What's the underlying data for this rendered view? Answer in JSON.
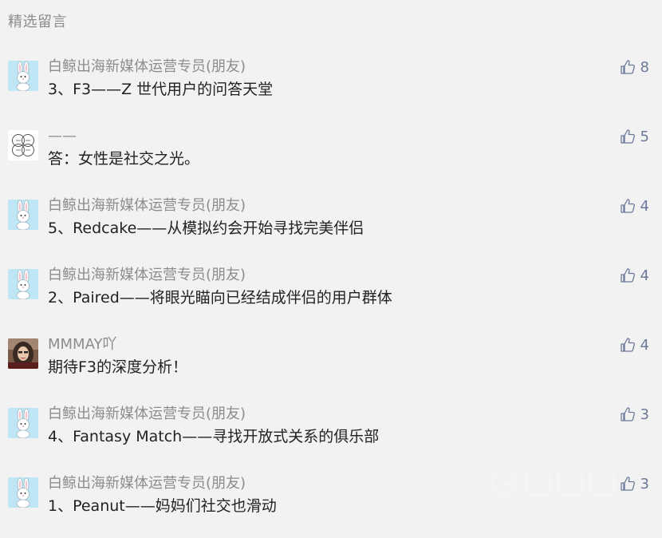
{
  "section_title": "精选留言",
  "comments": [
    {
      "avatar": "bunny-avatar",
      "nickname": "白鲸出海新媒体运营专员(朋友)",
      "content": "3、F3——Z 世代用户的问答天堂",
      "likes": "8"
    },
    {
      "avatar": "circles-avatar",
      "nickname": "——",
      "content": "答：女性是社交之光。",
      "likes": "5"
    },
    {
      "avatar": "bunny-avatar",
      "nickname": "白鲸出海新媒体运营专员(朋友)",
      "content": "5、Redcake——从模拟约会开始寻找完美伴侣",
      "likes": "4"
    },
    {
      "avatar": "bunny-avatar",
      "nickname": "白鲸出海新媒体运营专员(朋友)",
      "content": "2、Paired——将眼光瞄向已经结成伴侣的用户群体",
      "likes": "4"
    },
    {
      "avatar": "photo-avatar",
      "nickname": "MMMAY吖",
      "content": "期待F3的深度分析！",
      "likes": "4"
    },
    {
      "avatar": "bunny-avatar",
      "nickname": "白鲸出海新媒体运营专员(朋友)",
      "content": "4、Fantasy Match——寻找开放式关系的俱乐部",
      "likes": "3"
    },
    {
      "avatar": "bunny-avatar",
      "nickname": "白鲸出海新媒体运营专员(朋友)",
      "content": "1、Peanut——妈妈们社交也滑动",
      "likes": "3"
    }
  ],
  "colors": {
    "background": "#f2f2f2",
    "nickname": "#8c8c8c",
    "content": "#222222",
    "like": "#6b7a99",
    "bunny_bg": "#bfe6f5"
  },
  "icons": {
    "like": "thumbs-up-icon"
  }
}
